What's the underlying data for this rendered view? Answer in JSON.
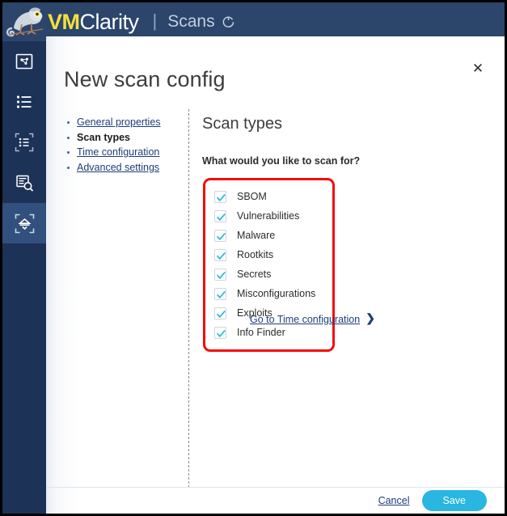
{
  "header": {
    "logo_icon": "chameleon-logo-icon",
    "brand_vm": "VM",
    "brand_clarity": "Clarity",
    "separator": "|",
    "page_name": "Scans",
    "refresh_icon": "refresh-icon",
    "bar_color": "#2b456b",
    "brand_accent": "#f5e03c"
  },
  "sidebar": {
    "background": "#1d3257",
    "active_background": "#31507e",
    "items": [
      {
        "name": "dashboard",
        "icon": "dashboard-chart-icon",
        "active": false
      },
      {
        "name": "assets",
        "icon": "list-icon",
        "active": false
      },
      {
        "name": "asset-scans",
        "icon": "scoped-list-icon",
        "active": false
      },
      {
        "name": "findings",
        "icon": "report-search-icon",
        "active": false
      },
      {
        "name": "scans",
        "icon": "scan-target-icon",
        "active": true
      }
    ]
  },
  "modal": {
    "title": "New scan config",
    "close_icon": "close-icon",
    "steps": [
      {
        "label": "General properties",
        "current": false
      },
      {
        "label": "Scan types",
        "current": true
      },
      {
        "label": "Time configuration",
        "current": false
      },
      {
        "label": "Advanced settings",
        "current": false
      }
    ],
    "content": {
      "title": "Scan types",
      "question": "What would you like to scan for?",
      "highlight_color": "#f50b0b",
      "checkbox_accent": "#29b6e0",
      "checkboxes": [
        {
          "label": "SBOM",
          "checked": true
        },
        {
          "label": "Vulnerabilities",
          "checked": true
        },
        {
          "label": "Malware",
          "checked": true
        },
        {
          "label": "Rootkits",
          "checked": true
        },
        {
          "label": "Secrets",
          "checked": true
        },
        {
          "label": "Misconfigurations",
          "checked": true
        },
        {
          "label": "Exploits",
          "checked": true
        },
        {
          "label": "Info Finder",
          "checked": true
        }
      ],
      "next_link": "Go to Time configuration",
      "next_chevron": "chevron-right-icon"
    },
    "footer": {
      "cancel_label": "Cancel",
      "save_label": "Save",
      "save_color": "#29b6e0"
    }
  }
}
